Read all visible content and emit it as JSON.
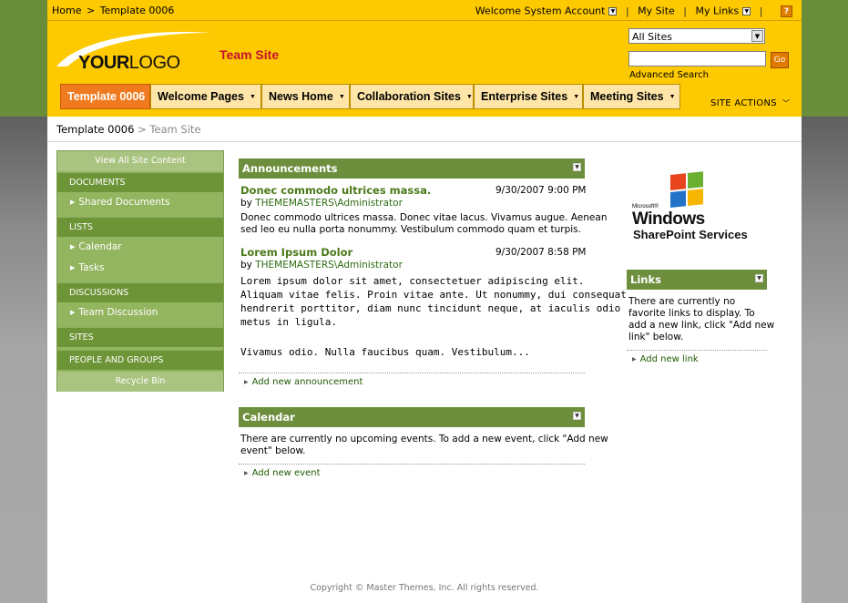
{
  "topbar": {
    "home": "Home",
    "sep": ">",
    "current": "Template 0006",
    "welcome": "Welcome System Account",
    "my_site": "My Site",
    "my_links": "My Links",
    "help_icon": "?"
  },
  "logo": {
    "bold": "YOUR",
    "light": "LOGO"
  },
  "site_title": "Team Site",
  "search": {
    "scope": "All Sites",
    "value": "",
    "go_label": "Go",
    "advanced": "Advanced Search"
  },
  "nav": [
    {
      "label": "Template 0006"
    },
    {
      "label": "Welcome Pages"
    },
    {
      "label": "News Home"
    },
    {
      "label": "Collaboration Sites"
    },
    {
      "label": "Enterprise Sites"
    },
    {
      "label": "Meeting Sites"
    }
  ],
  "site_actions": "SITE ACTIONS",
  "breadcrumb": {
    "parent": "Template 0006",
    "sep": ">",
    "current": "Team Site"
  },
  "leftnav": {
    "view_all": "View All Site Content",
    "documents": "DOCUMENTS",
    "shared_documents": "Shared Documents",
    "lists": "LISTS",
    "calendar": "Calendar",
    "tasks": "Tasks",
    "discussions": "DISCUSSIONS",
    "team_discussion": "Team Discussion",
    "sites": "SITES",
    "people_groups": "PEOPLE AND GROUPS",
    "recycle_bin": "Recycle Bin"
  },
  "announcements": {
    "title": "Announcements",
    "items": [
      {
        "title": "Donec commodo ultrices massa.",
        "date": "9/30/2007 9:00 PM",
        "by": "by",
        "author": "THEMEMASTERS\\Administrator",
        "body_line1": "Donec commodo ultrices massa. Donec vitae lacus. Vivamus augue. Aenean",
        "body_line2": "sed leo eu nulla porta nonummy. Vestibulum commodo quam et turpis."
      },
      {
        "title": "Lorem Ipsum Dolor",
        "date": "9/30/2007 8:58 PM",
        "by": "by",
        "author": "THEMEMASTERS\\Administrator",
        "body_line1": "Lorem ipsum dolor sit amet, consectetuer adipiscing elit.",
        "body_line2": "Aliquam vitae felis. Proin vitae ante. Ut nonummy, dui consequat",
        "body_line3": "hendrerit porttitor, diam nunc tincidunt neque, at iaculis odio",
        "body_line4": "metus in ligula.",
        "body_line5": "Vivamus odio. Nulla faucibus quam. Vestibulum..."
      }
    ],
    "add": "Add new announcement"
  },
  "calendar": {
    "title": "Calendar",
    "empty_line1": "There are currently no upcoming events. To add a new event, click \"Add new",
    "empty_line2": "event\" below.",
    "add": "Add new event"
  },
  "windows_logo": {
    "microsoft": "Microsoft®",
    "windows": "Windows",
    "sharepoint": "SharePoint Services"
  },
  "links": {
    "title": "Links",
    "line1": "There are currently no",
    "line2": "favorite links to display. To",
    "line3": "add a new link, click \"Add new",
    "line4": "link\" below.",
    "add": "Add new link"
  },
  "copyright": "Copyright © Master Themes, Inc. All rights reserved."
}
